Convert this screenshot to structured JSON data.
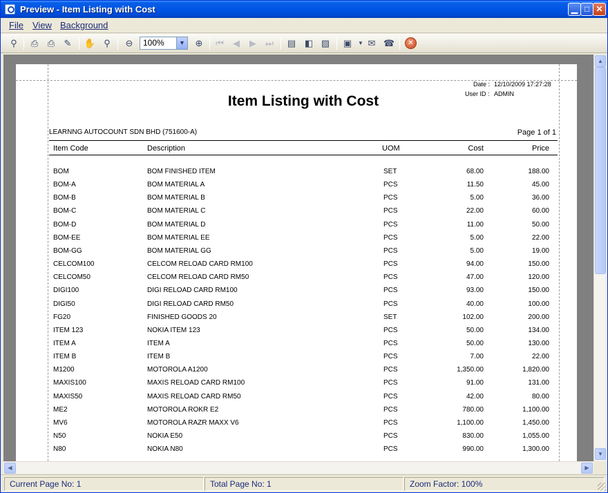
{
  "window": {
    "title": "Preview - Item Listing with Cost"
  },
  "menu": [
    "File",
    "View",
    "Background"
  ],
  "toolbar": {
    "zoom_value": "100%"
  },
  "report": {
    "date_label": "Date :",
    "date_value": "12/10/2009 17:27:28",
    "user_label": "User ID :",
    "user_value": "ADMIN",
    "title": "Item Listing with Cost",
    "company": "LEARNNG AUTOCOUNT SDN BHD (751600-A)",
    "page_info": "Page 1 of 1",
    "columns": [
      "Item Code",
      "Description",
      "UOM",
      "Cost",
      "Price"
    ],
    "rows": [
      [
        "BOM",
        "BOM FINISHED ITEM",
        "SET",
        "68.00",
        "188.00"
      ],
      [
        "BOM-A",
        "BOM MATERIAL A",
        "PCS",
        "11.50",
        "45.00"
      ],
      [
        "BOM-B",
        "BOM MATERIAL B",
        "PCS",
        "5.00",
        "36.00"
      ],
      [
        "BOM-C",
        "BOM MATERIAL C",
        "PCS",
        "22.00",
        "60.00"
      ],
      [
        "BOM-D",
        "BOM MATERIAL D",
        "PCS",
        "11.00",
        "50.00"
      ],
      [
        "BOM-EE",
        "BOM MATERIAL EE",
        "PCS",
        "5.00",
        "22.00"
      ],
      [
        "BOM-GG",
        "BOM MATERIAL GG",
        "PCS",
        "5.00",
        "19.00"
      ],
      [
        "CELCOM100",
        "CELCOM RELOAD CARD RM100",
        "PCS",
        "94.00",
        "150.00"
      ],
      [
        "CELCOM50",
        "CELCOM RELOAD CARD RM50",
        "PCS",
        "47.00",
        "120.00"
      ],
      [
        "DIGI100",
        "DIGI RELOAD CARD RM100",
        "PCS",
        "93.00",
        "150.00"
      ],
      [
        "DIGI50",
        "DIGI RELOAD CARD RM50",
        "PCS",
        "40.00",
        "100.00"
      ],
      [
        "FG20",
        "FINISHED GOODS 20",
        "SET",
        "102.00",
        "200.00"
      ],
      [
        "ITEM 123",
        "NOKIA ITEM 123",
        "PCS",
        "50.00",
        "134.00"
      ],
      [
        "ITEM A",
        "ITEM A",
        "PCS",
        "50.00",
        "130.00"
      ],
      [
        "ITEM B",
        "ITEM B",
        "PCS",
        "7.00",
        "22.00"
      ],
      [
        "M1200",
        "MOTOROLA A1200",
        "PCS",
        "1,350.00",
        "1,820.00"
      ],
      [
        "MAXIS100",
        "MAXIS RELOAD CARD RM100",
        "PCS",
        "91.00",
        "131.00"
      ],
      [
        "MAXIS50",
        "MAXIS RELOAD CARD RM50",
        "PCS",
        "42.00",
        "80.00"
      ],
      [
        "ME2",
        "MOTOROLA ROKR E2",
        "PCS",
        "780.00",
        "1,100.00"
      ],
      [
        "MV6",
        "MOTOROLA RAZR MAXX V6",
        "PCS",
        "1,100.00",
        "1,450.00"
      ],
      [
        "N50",
        "NOKIA E50",
        "PCS",
        "830.00",
        "1,055.00"
      ],
      [
        "N80",
        "NOKIA N80",
        "PCS",
        "990.00",
        "1,300.00"
      ]
    ]
  },
  "status": {
    "current_page": "Current Page No: 1",
    "total_page": "Total Page No: 1",
    "zoom_factor": "Zoom Factor: 100%"
  }
}
